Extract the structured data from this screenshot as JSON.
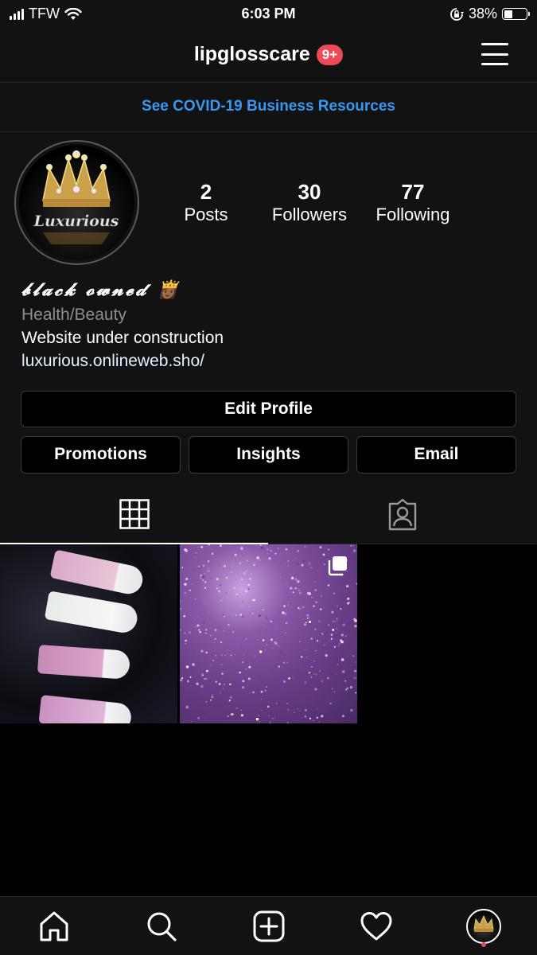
{
  "status_bar": {
    "carrier": "TFW",
    "time": "6:03 PM",
    "battery_percent": "38%",
    "battery_level": 0.38
  },
  "header": {
    "username": "lipglosscare",
    "notification_badge": "9+",
    "badge_color": "#ed4956"
  },
  "banner": {
    "text": "See COVID-19 Business Resources",
    "color": "#3897f0"
  },
  "profile": {
    "avatar_text": "Luxurious",
    "stats": [
      {
        "value": "2",
        "label": "Posts"
      },
      {
        "value": "30",
        "label": "Followers"
      },
      {
        "value": "77",
        "label": "Following"
      }
    ],
    "name": "𝓫𝓵𝓪𝓬𝓴 𝓸𝔀𝓷𝓮𝓭 👸🏾",
    "category": "Health/Beauty",
    "bio": "Website under construction",
    "link": "luxurious.onlineweb.sho/"
  },
  "buttons": {
    "edit_profile": "Edit Profile",
    "promotions": "Promotions",
    "insights": "Insights",
    "email": "Email"
  },
  "tabs": [
    {
      "icon": "grid-icon",
      "active": true
    },
    {
      "icon": "tagged-person-icon",
      "active": false
    }
  ],
  "posts": [
    {
      "subject": "lip gloss tubes",
      "multiple": false
    },
    {
      "subject": "purple glitter",
      "multiple": true
    }
  ],
  "bottom_nav": [
    "home-icon",
    "search-icon",
    "new-post-icon",
    "activity-heart-icon",
    "profile-avatar"
  ]
}
